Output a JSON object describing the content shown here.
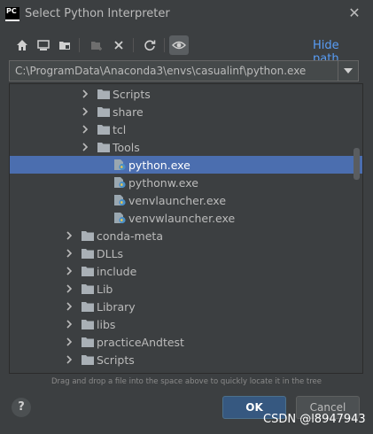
{
  "window": {
    "title": "Select Python Interpreter",
    "app_icon_text": "PC"
  },
  "toolbar": {
    "buttons": [
      "home-icon",
      "desktop-icon",
      "project-folder-icon",
      "new-folder-icon",
      "delete-icon",
      "refresh-icon",
      "show-hidden-icon"
    ],
    "hide_path_label": "Hide path"
  },
  "path": {
    "value": "C:\\ProgramData\\Anaconda3\\envs\\casualinf\\python.exe"
  },
  "tree": {
    "items": [
      {
        "label": "Scripts",
        "type": "folder",
        "level": 2,
        "selected": false
      },
      {
        "label": "share",
        "type": "folder",
        "level": 2,
        "selected": false
      },
      {
        "label": "tcl",
        "type": "folder",
        "level": 2,
        "selected": false
      },
      {
        "label": "Tools",
        "type": "folder",
        "level": 2,
        "selected": false
      },
      {
        "label": "python.exe",
        "type": "python-file",
        "level": 3,
        "selected": true
      },
      {
        "label": "pythonw.exe",
        "type": "python-file",
        "level": 3,
        "selected": false
      },
      {
        "label": "venvlauncher.exe",
        "type": "python-file",
        "level": 3,
        "selected": false
      },
      {
        "label": "venvwlauncher.exe",
        "type": "python-file",
        "level": 3,
        "selected": false
      },
      {
        "label": "conda-meta",
        "type": "folder",
        "level": 1,
        "selected": false
      },
      {
        "label": "DLLs",
        "type": "folder",
        "level": 1,
        "selected": false
      },
      {
        "label": "include",
        "type": "folder",
        "level": 1,
        "selected": false
      },
      {
        "label": "Lib",
        "type": "folder",
        "level": 1,
        "selected": false
      },
      {
        "label": "Library",
        "type": "folder",
        "level": 1,
        "selected": false
      },
      {
        "label": "libs",
        "type": "folder",
        "level": 1,
        "selected": false
      },
      {
        "label": "practiceAndtest",
        "type": "folder",
        "level": 1,
        "selected": false
      },
      {
        "label": "Scripts",
        "type": "folder",
        "level": 1,
        "selected": false
      },
      {
        "label": "",
        "type": "folder",
        "level": 1,
        "selected": false
      }
    ]
  },
  "hint": "Drag and drop a file into the space above to quickly locate it in the tree",
  "footer": {
    "help_label": "?",
    "ok_label": "OK",
    "cancel_label": "Cancel"
  },
  "watermark": "CSDN @l8947943",
  "colors": {
    "background": "#3c3f41",
    "selection": "#4b6eaf",
    "link": "#589df6",
    "ok_button": "#365880"
  }
}
